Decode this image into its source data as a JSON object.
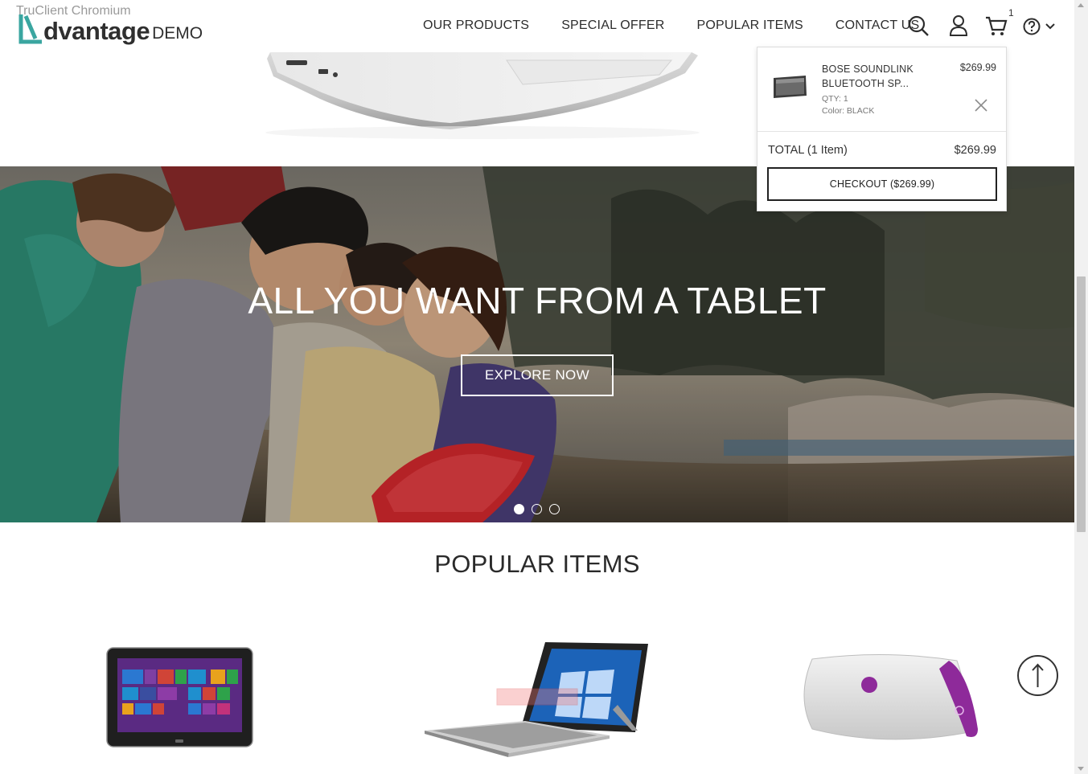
{
  "browser": {
    "watermark": "TruClient Chromium"
  },
  "header": {
    "logo_word": "dvantage",
    "logo_demo": "DEMO",
    "nav": [
      "OUR PRODUCTS",
      "SPECIAL OFFER",
      "POPULAR ITEMS",
      "CONTACT US"
    ],
    "cart_count": "1",
    "icons": [
      "search-icon",
      "user-icon",
      "cart-icon",
      "help-icon",
      "chevron-down-icon"
    ]
  },
  "hero": {
    "title": "ALL YOU WANT FROM A TABLET",
    "button_label": "EXPLORE NOW",
    "slides": 3,
    "active_slide": 0
  },
  "popular": {
    "title": "POPULAR ITEMS"
  },
  "cart": {
    "item": {
      "name": "BOSE SOUNDLINK BLUETOOTH SP...",
      "price": "$269.99",
      "qty": "QTY: 1",
      "color": "Color: BLACK"
    },
    "total_label": "TOTAL (1 Item)",
    "total_value": "$269.99",
    "checkout_label": "CHECKOUT ($269.99)"
  },
  "colors": {
    "logo_accent": "#3aa6a0",
    "tablet_screen": "#5a2a82",
    "speaker_accent": "#8e2a9a"
  }
}
